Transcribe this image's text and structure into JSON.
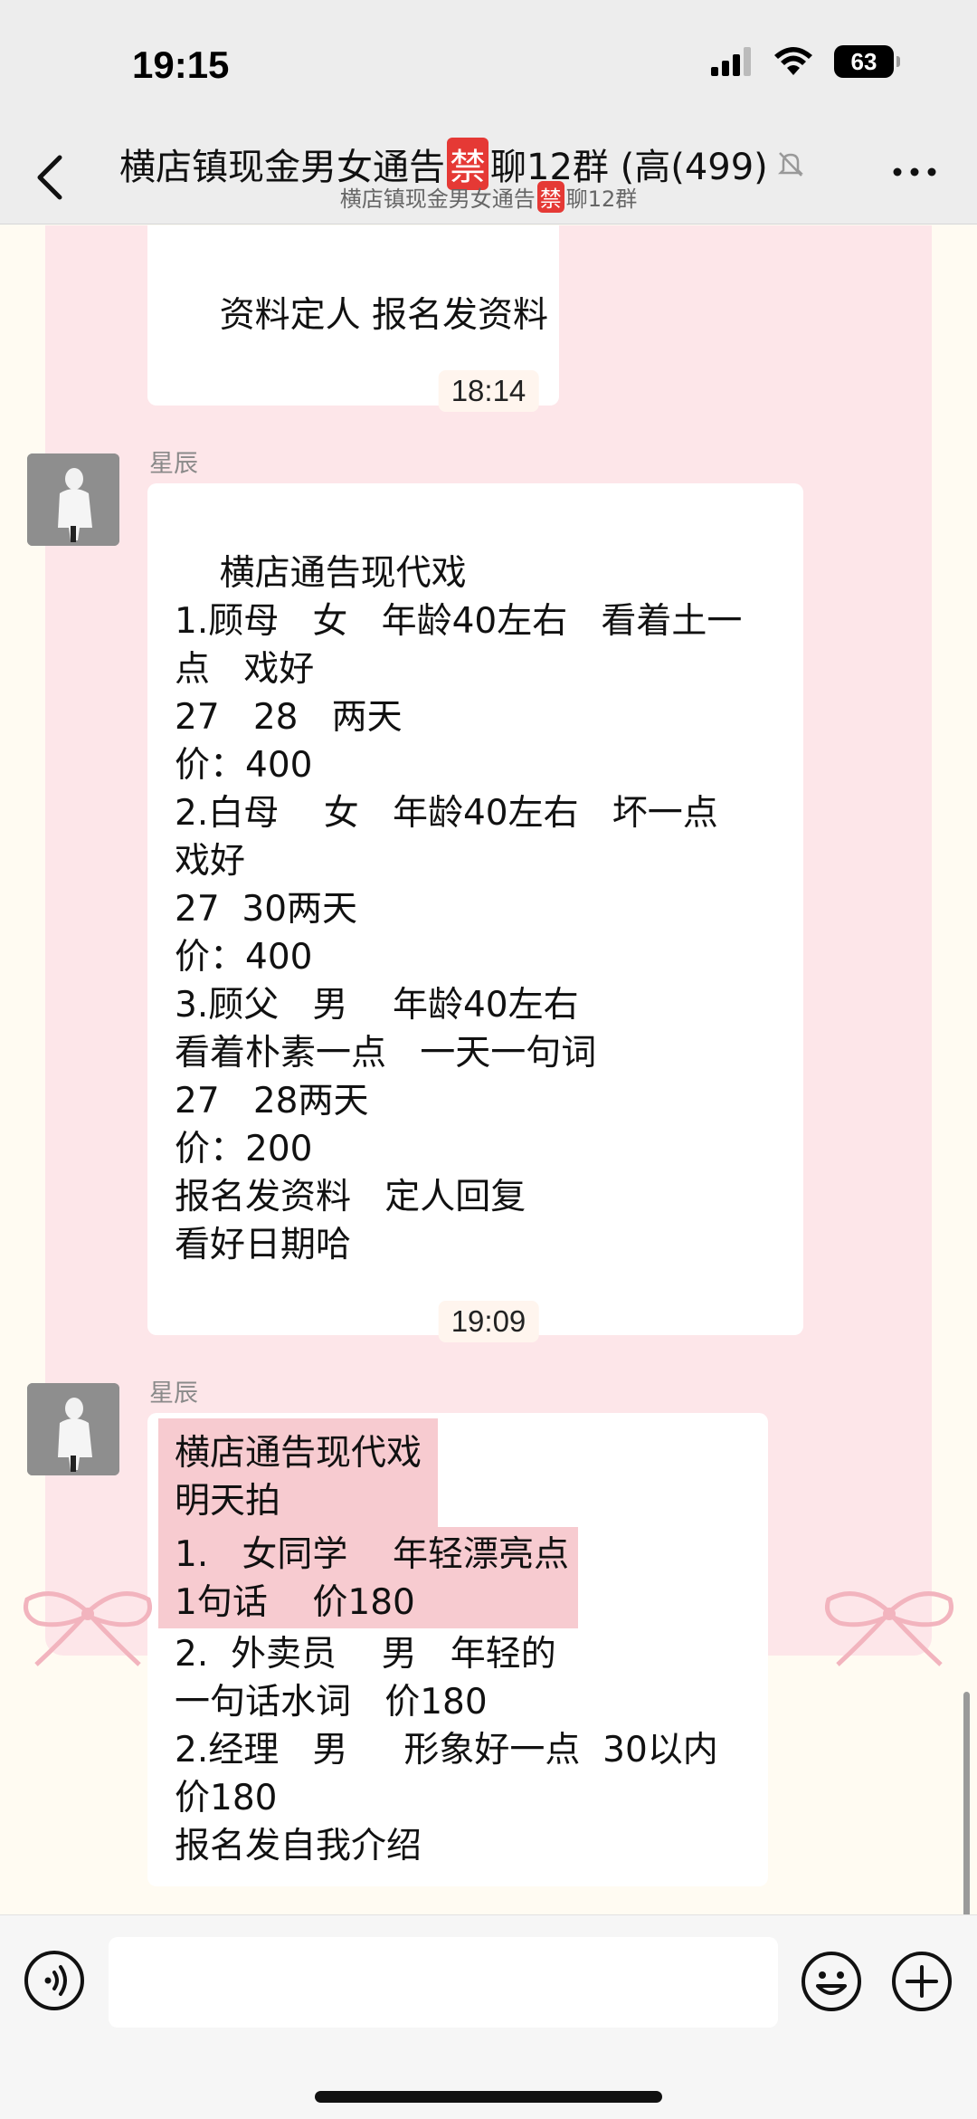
{
  "status_bar": {
    "time": "19:15",
    "battery": "63"
  },
  "header": {
    "title_part1": "横店镇现金男女通告",
    "title_ban": "禁",
    "title_part2": "聊12群 (高(499)",
    "subtitle_part1": "横店镇现金男女通告",
    "subtitle_ban": "禁",
    "subtitle_part2": "聊12群"
  },
  "messages": [
    {
      "text": "资料定人 报名发资料"
    },
    {
      "time": "18:14",
      "sender": "星辰",
      "text": "横店通告现代戏\n1.顾母   女   年龄40左右   看着土一\n点   戏好\n27   28   两天\n价：400\n2.白母    女   年龄40左右   坏一点\n戏好\n27  30两天\n价：400\n3.顾父   男    年龄40左右\n看着朴素一点   一天一句词\n27   28两天\n价：200\n报名发资料   定人回复\n看好日期哈"
    },
    {
      "time": "19:09",
      "sender": "星辰",
      "highlight_a": "横店通告现代戏\n明天拍",
      "highlight_b": "1.   女同学    年轻漂亮点\n1句话    价180",
      "rest": "2.  外卖员    男   年轻的\n一句话水词   价180\n2.经理   男     形象好一点  30以内\n价180\n报名发自我介绍"
    }
  ],
  "input": {
    "placeholder": ""
  },
  "colors": {
    "header_bg": "#ededed",
    "chat_pink": "#fde6e9",
    "highlight": "#f7cbd0",
    "ban_red": "#e53935"
  }
}
